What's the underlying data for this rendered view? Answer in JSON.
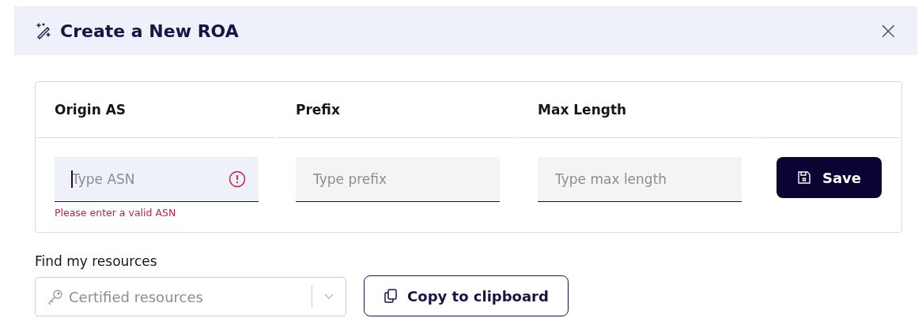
{
  "dialog": {
    "title": "Create a New ROA",
    "close": "×"
  },
  "form": {
    "columns": [
      "Origin AS",
      "Prefix",
      "Max Length"
    ],
    "fields": [
      {
        "placeholder": "Type ASN",
        "invalid": true,
        "focused": true,
        "error": "Please enter a valid ASN"
      },
      {
        "placeholder": "Type prefix",
        "invalid": false,
        "focused": false
      },
      {
        "placeholder": "Type max length",
        "invalid": false,
        "focused": false
      }
    ],
    "save_button": "Save"
  },
  "resources": {
    "label": "Find my resources",
    "select_placeholder": "Certified resources",
    "copy_button": "Copy to clipboard"
  }
}
